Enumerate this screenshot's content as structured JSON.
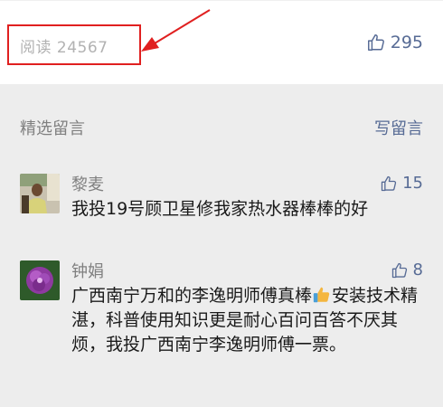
{
  "article": {
    "read_count_text": "阅读 24567",
    "like_count": "295"
  },
  "comments_section": {
    "title": "精选留言",
    "write_label": "写留言"
  },
  "comments": [
    {
      "name": "黎麦",
      "likes": "15",
      "text": "我投19号顾卫星修我家热水器棒棒的好"
    },
    {
      "name": "钟娟",
      "likes": "8",
      "text_before_emoji": "广西南宁万和的李逸明师傅真棒",
      "emoji": "thumbs-up-emoji",
      "text_after_emoji": "安装技术精湛，科普使用知识更是耐心百问百答不厌其烦，我投广西南宁李逸明师傅一票。"
    }
  ],
  "colors": {
    "link": "#576b95",
    "muted": "#808080",
    "annotation": "#e02020",
    "page_bg": "#ededed"
  }
}
